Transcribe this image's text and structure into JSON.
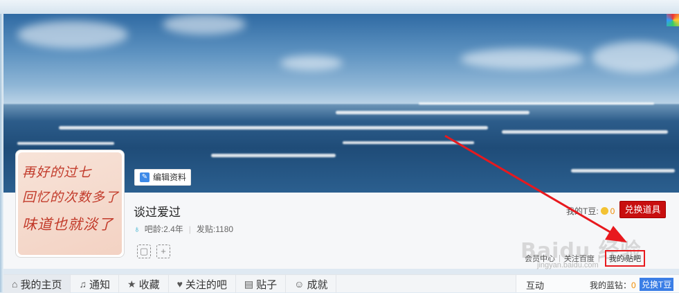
{
  "profile": {
    "username": "谈过爱过",
    "edit_label": "编辑资料",
    "age_label": "吧龄:2.4年",
    "posts_label": "发贴:1180",
    "avatar_lines": [
      "再好的过七",
      "回忆的次数多了",
      "味道也就淡了"
    ]
  },
  "tdou": {
    "label": "我的T豆:",
    "count": "0",
    "exchange_label": "兑换道具"
  },
  "links": {
    "member": "会员中心",
    "follow": "关注百度",
    "my_tieba": "我的i贴吧"
  },
  "watermark": {
    "main": "Baidu 经验",
    "sub": "jingyan.baidu.com"
  },
  "nav": {
    "items": [
      {
        "icon": "⌂",
        "label": "我的主页"
      },
      {
        "icon": "♫",
        "label": "通知"
      },
      {
        "icon": "★",
        "label": "收藏"
      },
      {
        "icon": "♥",
        "label": "关注的吧"
      },
      {
        "icon": "▤",
        "label": "贴子"
      },
      {
        "icon": "☺",
        "label": "成就"
      }
    ]
  },
  "side": {
    "title": "互动",
    "diamond_label": "我的蓝钻：",
    "diamond_value": "0",
    "exchange_label": "兑换T豆"
  },
  "colors": {
    "accent_red": "#c80f0f",
    "annotation_red": "#e8191e",
    "exchange_blue": "#3b7ee6"
  }
}
